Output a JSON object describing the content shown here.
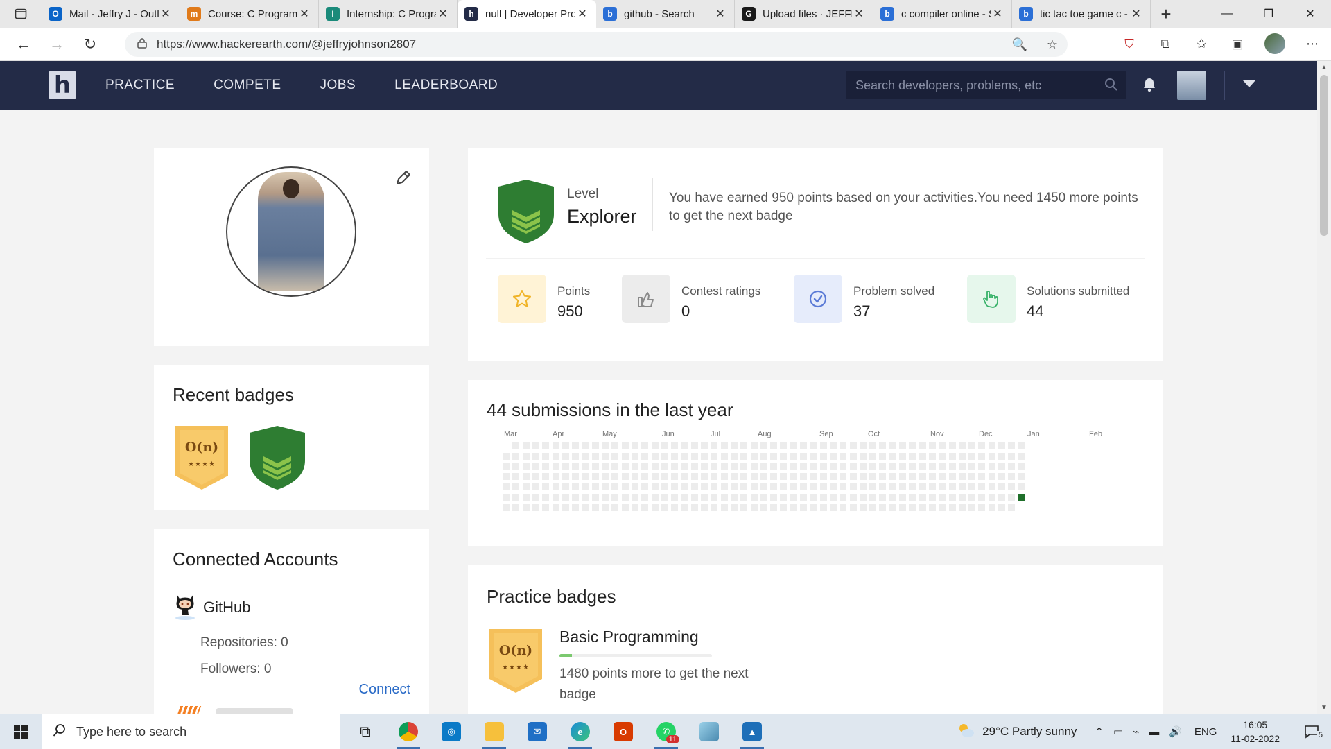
{
  "browser": {
    "tabs": [
      {
        "title": "Mail - Jeffry J - Outlook",
        "favicon_color": "#0a64c8",
        "favicon_text": "O"
      },
      {
        "title": "Course: C Programming",
        "favicon_color": "#e07a1a",
        "favicon_text": "m"
      },
      {
        "title": "Internship: C Programming",
        "favicon_color": "#1a8a7a",
        "favicon_text": "I"
      },
      {
        "title": "null | Developer Profile",
        "favicon_color": "#232b47",
        "favicon_text": "h",
        "active": true
      },
      {
        "title": "github - Search",
        "favicon_color": "#2b6fd6",
        "favicon_text": "b"
      },
      {
        "title": "Upload files · JEFFRY",
        "favicon_color": "#1a1a1a",
        "favicon_text": "G"
      },
      {
        "title": "c compiler online - Search",
        "favicon_color": "#2b6fd6",
        "favicon_text": "b"
      },
      {
        "title": "tic tac toe game c - Search",
        "favicon_color": "#2b6fd6",
        "favicon_text": "b"
      }
    ],
    "url": "https://www.hackerearth.com/@jeffryjohnson2807"
  },
  "header": {
    "logo_text": "h",
    "nav": [
      "PRACTICE",
      "COMPETE",
      "JOBS",
      "LEADERBOARD"
    ],
    "search_placeholder": "Search developers, problems, etc"
  },
  "level": {
    "label": "Level",
    "value": "Explorer",
    "description": "You have earned 950 points based on your activities.You need 1450 more points to get the next badge"
  },
  "stats": [
    {
      "label": "Points",
      "value": "950",
      "icon": "star-icon",
      "bg": "#fff3d6",
      "color": "#f0b429"
    },
    {
      "label": "Contest ratings",
      "value": "0",
      "icon": "thumbs-up-icon",
      "bg": "#ececec",
      "color": "#8a8a8a"
    },
    {
      "label": "Problem solved",
      "value": "37",
      "icon": "check-circle-icon",
      "bg": "#e6ecfb",
      "color": "#5a7ad6"
    },
    {
      "label": "Solutions submitted",
      "value": "44",
      "icon": "pointer-hand-icon",
      "bg": "#e6f7ec",
      "color": "#39b26a"
    }
  ],
  "recent_badges": {
    "title": "Recent badges",
    "badges": [
      {
        "type": "complexity",
        "text": "O(n)",
        "stars": "★★★★"
      },
      {
        "type": "level-shield"
      }
    ]
  },
  "activity": {
    "title": "44 submissions in the last year",
    "months": [
      "Mar",
      "Apr",
      "May",
      "Jun",
      "Jul",
      "Aug",
      "Sep",
      "Oct",
      "Nov",
      "Dec",
      "Jan",
      "Feb"
    ]
  },
  "accounts": {
    "title": "Connected Accounts",
    "github": {
      "name": "GitHub",
      "repositories": "Repositories: 0",
      "followers": "Followers: 0",
      "connect": "Connect"
    }
  },
  "practice": {
    "title": "Practice badges",
    "badge_text": "O(n)",
    "badge_stars": "★★★★",
    "name": "Basic Programming",
    "progress_percent": 8,
    "desc": "1480 points more to get the next badge"
  },
  "taskbar": {
    "search_placeholder": "Type here to search",
    "whatsapp_badge": "11",
    "weather": "29°C  Partly sunny",
    "lang": "ENG",
    "time": "16:05",
    "date": "11-02-2022",
    "notif_count": "5"
  },
  "colors": {
    "header_bg": "#232b47",
    "shield_green": "#2e7d32",
    "badge_gold": "#f5c05a",
    "link_blue": "#2a6bc7"
  }
}
